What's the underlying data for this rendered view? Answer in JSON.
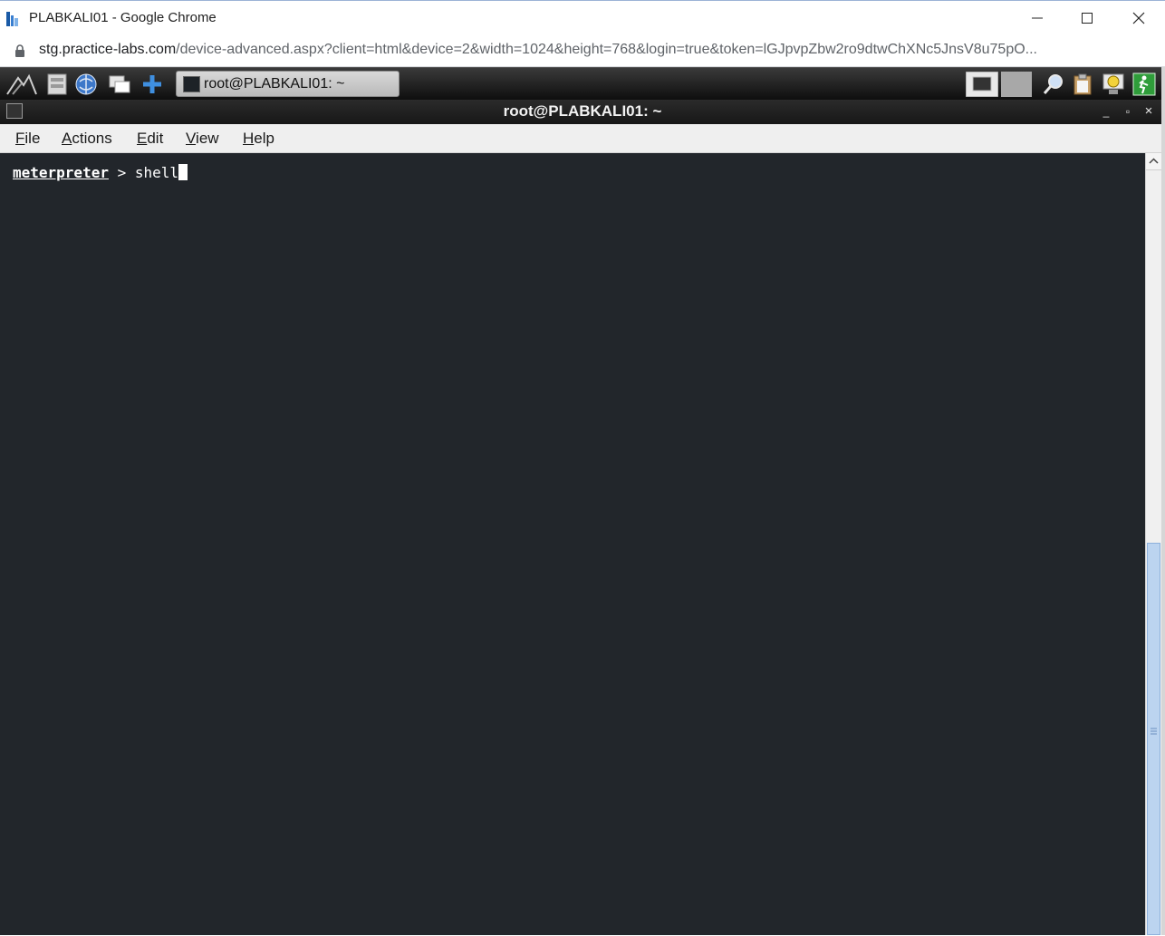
{
  "browser": {
    "window_title": "PLABKALI01 - Google Chrome",
    "url_host": "stg.practice-labs.com",
    "url_rest": "/device-advanced.aspx?client=html&device=2&width=1024&height=768&login=true&token=lGJpvpZbw2ro9dtwChXNc5JnsV8u75pO..."
  },
  "taskbar": {
    "task_button_label": "root@PLABKALI01: ~"
  },
  "terminal_window": {
    "title": "root@PLABKALI01: ~",
    "minimize_glyph": "_",
    "maximize_glyph": "▫",
    "close_glyph": "×"
  },
  "menu": {
    "items": [
      {
        "mnemonic": "F",
        "rest": "ile"
      },
      {
        "mnemonic": "A",
        "rest": "ctions"
      },
      {
        "mnemonic": "E",
        "rest": "dit"
      },
      {
        "mnemonic": "V",
        "rest": "iew"
      },
      {
        "mnemonic": "H",
        "rest": "elp"
      }
    ]
  },
  "terminal": {
    "prompt": "meterpreter",
    "separator": " > ",
    "command": "shell"
  },
  "colors": {
    "terminal_bg": "#22262b",
    "scroll_thumb": "#bcd4f0"
  }
}
